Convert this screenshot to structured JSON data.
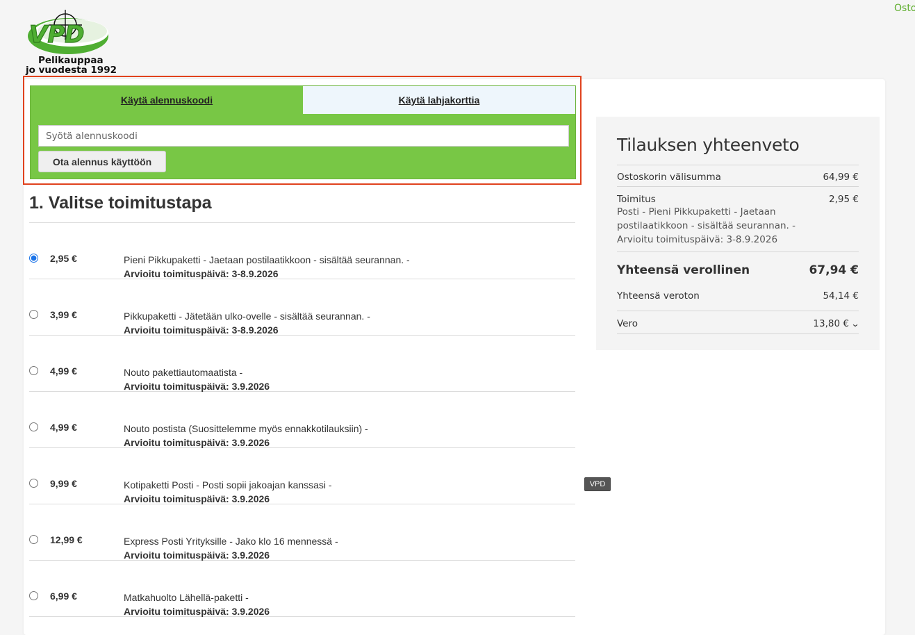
{
  "header": {
    "top_link": "Ostoskori",
    "logo": {
      "brand": "VPD",
      "tagline_1": "Pelikauppaa",
      "tagline_2": "jo vuodesta 1992"
    }
  },
  "discount": {
    "tabs": [
      {
        "label": "Käytä alennuskoodi",
        "active": true
      },
      {
        "label": "Käytä lahjakorttia",
        "active": false
      }
    ],
    "input_placeholder": "Syötä alennuskoodi",
    "apply_label": "Ota alennus käyttöön"
  },
  "shipping": {
    "title": "1. Valitse toimitustapa",
    "options": [
      {
        "price": "2,95 €",
        "desc": "Pieni Pikkupaketti - Jaetaan postilaatikkoon - sisältää seurannan. -",
        "eta": "Arvioitu toimituspäivä: 3-8.9.2026",
        "selected": true
      },
      {
        "price": "3,99 €",
        "desc": "Pikkupaketti - Jätetään ulko-ovelle - sisältää seurannan. -",
        "eta": "Arvioitu toimituspäivä: 3-8.9.2026",
        "selected": false
      },
      {
        "price": "4,99 €",
        "desc": "Nouto pakettiautomaatista -",
        "eta": "Arvioitu toimituspäivä: 3.9.2026",
        "selected": false
      },
      {
        "price": "4,99 €",
        "desc": "Nouto postista (Suosittelemme myös ennakkotilauksiin) -",
        "eta": "Arvioitu toimituspäivä: 3.9.2026",
        "selected": false
      },
      {
        "price": "9,99 €",
        "desc": "Kotipaketti Posti - Posti sopii jakoajan kanssasi -",
        "eta": "Arvioitu toimituspäivä: 3.9.2026",
        "selected": false
      },
      {
        "price": "12,99 €",
        "desc": "Express Posti Yrityksille - Jako klo 16 mennessä -",
        "eta": "Arvioitu toimituspäivä: 3.9.2026",
        "selected": false
      },
      {
        "price": "6,99 €",
        "desc": "Matkahuolto Lähellä-paketti -",
        "eta": "Arvioitu toimituspäivä: 3.9.2026",
        "selected": false
      }
    ]
  },
  "summary": {
    "title": "Tilauksen yhteenveto",
    "subtotal_label": "Ostoskorin välisumma",
    "subtotal_value": "64,99 €",
    "shipping_label": "Toimitus",
    "shipping_value": "2,95 €",
    "shipping_detail": "Posti - Pieni Pikkupaketti - Jaetaan postilaatikkoon - sisältää seurannan. - Arvioitu toimituspäivä: 3-8.9.2026",
    "total_label": "Yhteensä verollinen",
    "total_value": "67,94 €",
    "net_label": "Yhteensä veroton",
    "net_value": "54,14 €",
    "tax_label": "Vero",
    "tax_value": "13,80 €"
  },
  "tooltip": "VPD",
  "colors": {
    "green": "#78c745",
    "highlight": "#e0421d",
    "link": "#5fae2e"
  }
}
